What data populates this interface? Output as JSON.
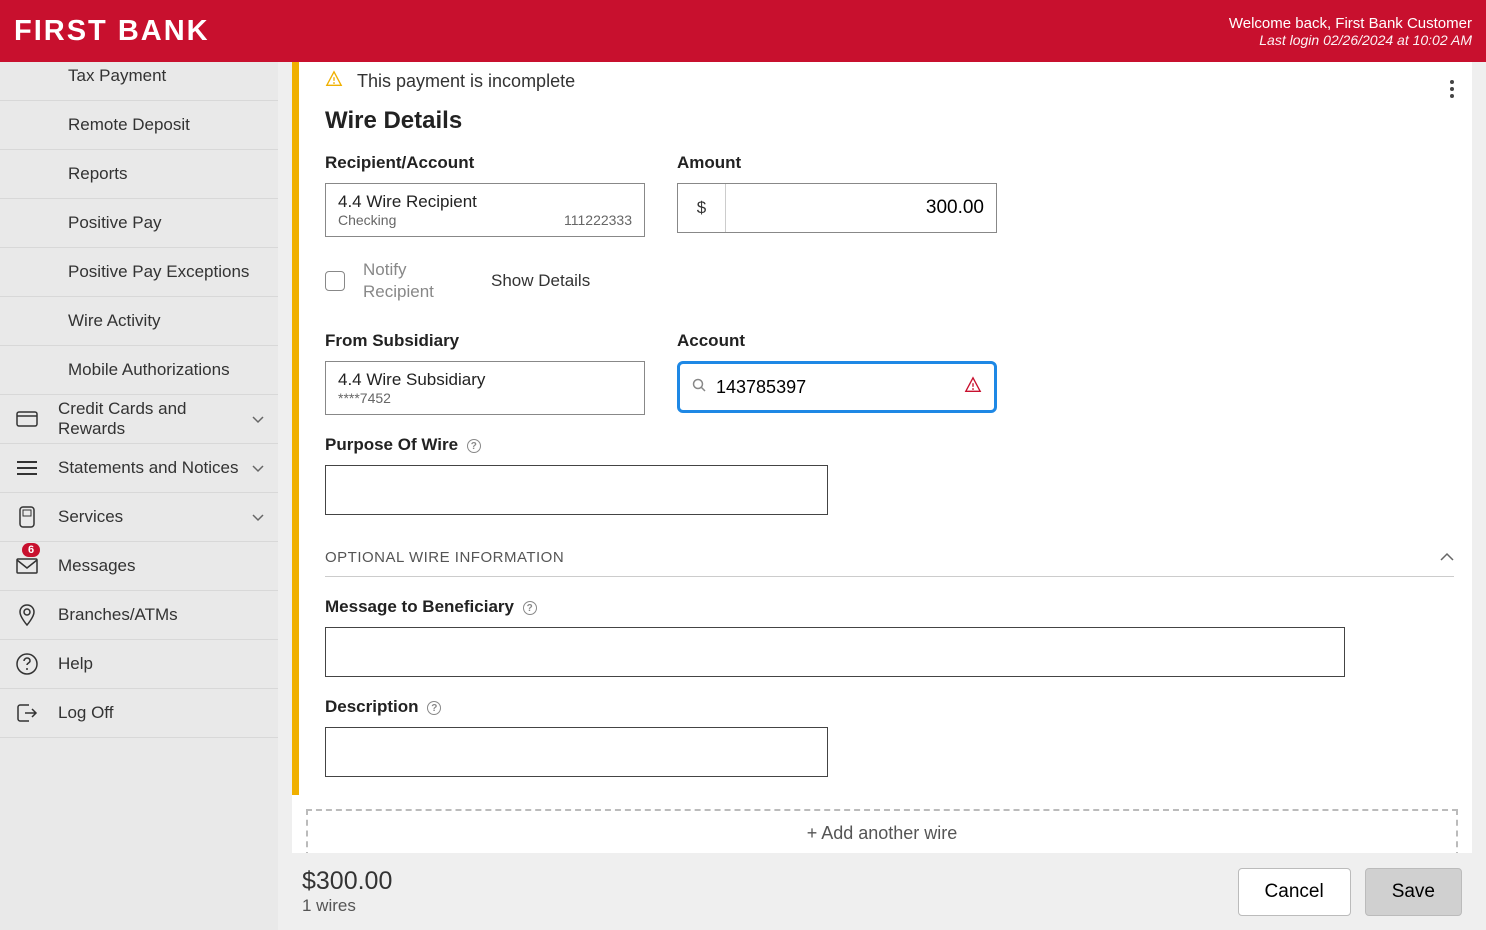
{
  "header": {
    "logo": "FIRST BANK",
    "welcome": "Welcome back, First Bank Customer",
    "last_login": "Last login 02/26/2024 at 10:02 AM"
  },
  "sidebar": {
    "items": [
      {
        "label": "Tax Payment",
        "sub": true
      },
      {
        "label": "Remote Deposit",
        "sub": true
      },
      {
        "label": "Reports",
        "sub": true
      },
      {
        "label": "Positive Pay",
        "sub": true
      },
      {
        "label": "Positive Pay Exceptions",
        "sub": true
      },
      {
        "label": "Wire Activity",
        "sub": true
      },
      {
        "label": "Mobile Authorizations",
        "sub": true
      },
      {
        "label": "Credit Cards and Rewards",
        "icon": "card",
        "chevron": true
      },
      {
        "label": "Statements and Notices",
        "icon": "lines",
        "chevron": true
      },
      {
        "label": "Services",
        "icon": "device",
        "chevron": true
      },
      {
        "label": "Messages",
        "icon": "mail",
        "badge": "6"
      },
      {
        "label": "Branches/ATMs",
        "icon": "pin"
      },
      {
        "label": "Help",
        "icon": "help"
      },
      {
        "label": "Log Off",
        "icon": "logout"
      }
    ]
  },
  "wire": {
    "incomplete_msg": "This payment is incomplete",
    "section_title": "Wire Details",
    "recipient_label": "Recipient/Account",
    "recipient_name": "4.4 Wire Recipient",
    "recipient_type": "Checking",
    "recipient_number": "111222333",
    "amount_label": "Amount",
    "amount_symbol": "$",
    "amount_value": "300.00",
    "notify_label": "Notify Recipient",
    "show_details": "Show Details",
    "subsidiary_label": "From Subsidiary",
    "subsidiary_name": "4.4 Wire Subsidiary",
    "subsidiary_mask": "****7452",
    "account_label": "Account",
    "account_value": "143785397",
    "purpose_label": "Purpose Of Wire",
    "optional_header": "OPTIONAL WIRE INFORMATION",
    "message_label": "Message to Beneficiary",
    "description_label": "Description",
    "add_wire": "+ Add another wire"
  },
  "footer": {
    "total": "$300.00",
    "count": "1 wires",
    "cancel": "Cancel",
    "save": "Save"
  }
}
